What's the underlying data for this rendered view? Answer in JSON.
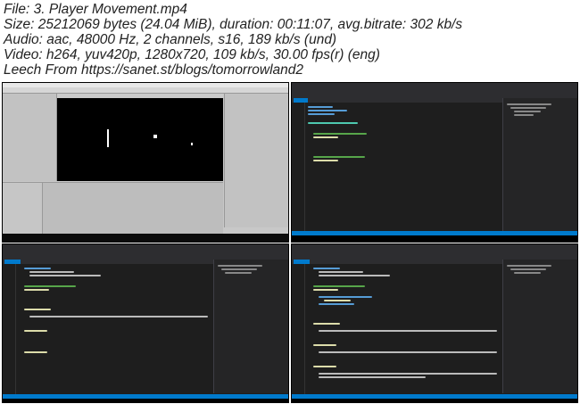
{
  "header": {
    "file": "File: 3. Player Movement.mp4",
    "size": "Size: 25212069 bytes (24.04 MiB), duration: 00:11:07, avg.bitrate: 302 kb/s",
    "audio": "Audio: aac, 48000 Hz, 2 channels, s16, 189 kb/s (und)",
    "video": "Video: h264, yuv420p, 1280x720, 109 kb/s, 30.00 fps(r) (eng)",
    "leech": "Leech From https://sanet.st/blogs/tomorrowland2"
  },
  "colors": {
    "vs_background": "#1e1e1e",
    "vs_chrome": "#2d2d30",
    "vs_accent": "#007acc",
    "unity_background": "#c8c8c8",
    "keyword": "#569cd6",
    "type": "#4ec9b0",
    "comment": "#57a64a",
    "method": "#dcdcaa"
  },
  "thumbnails": [
    {
      "name": "unity-editor"
    },
    {
      "name": "visual-studio-player-script"
    },
    {
      "name": "visual-studio-movement-methods"
    },
    {
      "name": "visual-studio-bounds-method"
    }
  ]
}
